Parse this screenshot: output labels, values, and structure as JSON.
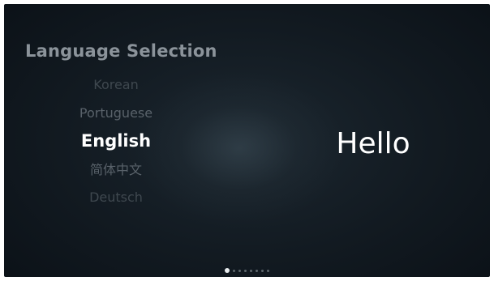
{
  "screen": {
    "title": "Language Selection",
    "greeting": "Hello"
  },
  "languages": [
    {
      "label": "Korean",
      "state": "far"
    },
    {
      "label": "Portuguese",
      "state": "near"
    },
    {
      "label": "English",
      "state": "selected"
    },
    {
      "label": "简体中文",
      "state": "near"
    },
    {
      "label": "Deutsch",
      "state": "far"
    }
  ],
  "pager": {
    "total_pages": 8,
    "current_page": 1
  },
  "colors": {
    "background": "#121a21",
    "heading": "#8b939a",
    "selected_text": "#ffffff",
    "dimmed_text": "#59626a"
  }
}
